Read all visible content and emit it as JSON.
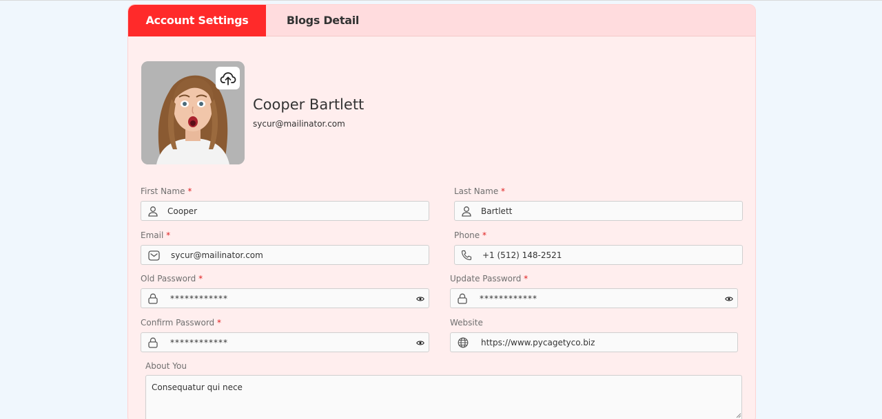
{
  "tabs": [
    {
      "label": "Account Settings",
      "active": true
    },
    {
      "label": "Blogs Detail",
      "active": false
    }
  ],
  "profile": {
    "name": "Cooper Bartlett",
    "email": "sycur@mailinator.com"
  },
  "form": {
    "first_name": {
      "label": "First Name",
      "value": "Cooper",
      "required": "*",
      "icon": "user-icon"
    },
    "last_name": {
      "label": "Last Name",
      "value": "Bartlett",
      "required": "*",
      "icon": "user-icon"
    },
    "email": {
      "label": "Email",
      "value": "sycur@mailinator.com",
      "required": "*",
      "icon": "mail-icon"
    },
    "phone": {
      "label": "Phone",
      "value": "+1 (512) 148-2521",
      "required": "*",
      "icon": "phone-icon"
    },
    "old_password": {
      "label": "Old Password",
      "value": "************",
      "required": "*",
      "icon": "lock-icon"
    },
    "update_password": {
      "label": "Update Password",
      "value": "************",
      "required": "*",
      "icon": "lock-icon"
    },
    "confirm_password": {
      "label": "Confirm Password",
      "value": "************",
      "required": "*",
      "icon": "lock-icon"
    },
    "website": {
      "label": "Website",
      "value": "https://www.pycagetyco.biz",
      "icon": "globe-icon"
    },
    "about": {
      "label": "About You",
      "value": "Consequatur qui nece"
    }
  },
  "colors": {
    "accent": "#ff2a2a",
    "tab_bar": "#ffdcde",
    "card_bg": "#ffeeee",
    "page_bg": "#f0f7fd",
    "required": "#e02020"
  }
}
